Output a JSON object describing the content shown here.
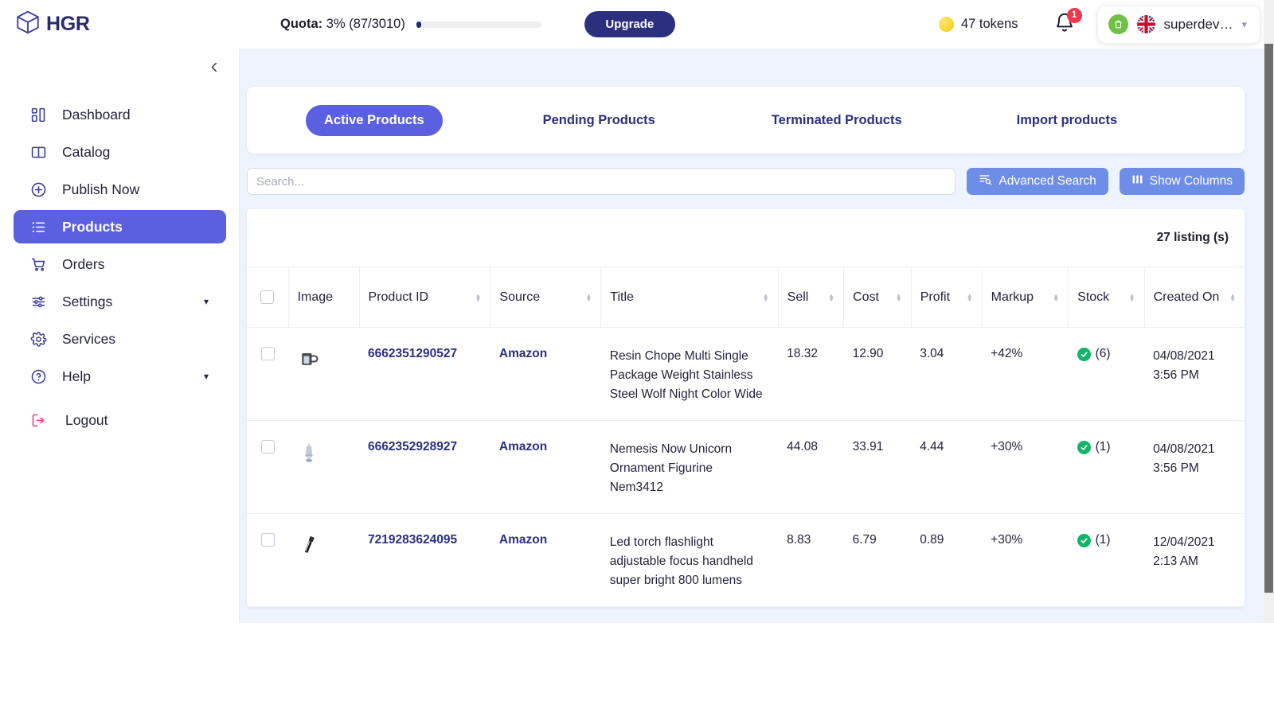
{
  "topbar": {
    "logo_text": "HGR",
    "logo_icon": "cube-icon",
    "quota_label_bold": "Quota:",
    "quota_value": "3% (87/3010)",
    "quota_percent": 3,
    "upgrade_label": "Upgrade",
    "tokens_text": "47 tokens",
    "coin_icon": "coin-icon",
    "bell_icon": "bell-icon",
    "notification_count": "1",
    "shopify_icon": "shopify-bag-icon",
    "shopify_color": "#6ec144",
    "flag_icon": "uk-flag-icon",
    "user_name": "superdev…",
    "chevron_icon": "chevron-down-icon"
  },
  "sidebar": {
    "collapse_icon": "chevron-left-icon",
    "items": [
      {
        "label": "Dashboard",
        "icon": "dashboard-icon",
        "active": false,
        "chevron": false
      },
      {
        "label": "Catalog",
        "icon": "book-icon",
        "active": false,
        "chevron": false
      },
      {
        "label": "Publish Now",
        "icon": "plus-circle-icon",
        "active": false,
        "chevron": false
      },
      {
        "label": "Products",
        "icon": "list-icon",
        "active": true,
        "chevron": false
      },
      {
        "label": "Orders",
        "icon": "cart-icon",
        "active": false,
        "chevron": false
      },
      {
        "label": "Settings",
        "icon": "sliders-icon",
        "active": false,
        "chevron": true
      },
      {
        "label": "Services",
        "icon": "gear-icon",
        "active": false,
        "chevron": false
      },
      {
        "label": "Help",
        "icon": "question-icon",
        "active": false,
        "chevron": true
      },
      {
        "label": "Logout",
        "icon": "logout-icon",
        "active": false,
        "chevron": false
      }
    ]
  },
  "main": {
    "tabs": [
      {
        "label": "Active Products",
        "active": true
      },
      {
        "label": "Pending Products",
        "active": false
      },
      {
        "label": "Terminated Products",
        "active": false
      },
      {
        "label": "Import products",
        "active": false
      }
    ],
    "search": {
      "value": "",
      "placeholder": "Search...",
      "advanced_label": "Advanced Search",
      "advanced_icon": "filter-search-icon",
      "columns_label": "Show Columns",
      "columns_icon": "columns-icon"
    },
    "listing_count": "27 listing (s)",
    "columns": [
      {
        "label": "Image",
        "sortable": false
      },
      {
        "label": "Product ID",
        "sortable": true
      },
      {
        "label": "Source",
        "sortable": true
      },
      {
        "label": "Title",
        "sortable": true
      },
      {
        "label": "Sell",
        "sortable": true
      },
      {
        "label": "Cost",
        "sortable": true
      },
      {
        "label": "Profit",
        "sortable": true
      },
      {
        "label": "Markup",
        "sortable": true
      },
      {
        "label": "Stock",
        "sortable": true
      },
      {
        "label": "Created On",
        "sortable": true
      }
    ],
    "rows": [
      {
        "thumb": "mug-thumbnail",
        "product_id": "6662351290527",
        "source": "Amazon",
        "title": "Resin Chope Multi Single Package Weight Stainless Steel Wolf Night Color Wide",
        "sell": "18.32",
        "cost": "12.90",
        "profit": "3.04",
        "markup": "+42%",
        "stock_status": "in-stock",
        "stock_count": "(6)",
        "created_date": "04/08/2021",
        "created_time": "3:56 PM"
      },
      {
        "thumb": "unicorn-figurine-thumbnail",
        "product_id": "6662352928927",
        "source": "Amazon",
        "title": "Nemesis Now Unicorn Ornament Figurine Nem3412",
        "sell": "44.08",
        "cost": "33.91",
        "profit": "4.44",
        "markup": "+30%",
        "stock_status": "in-stock",
        "stock_count": "(1)",
        "created_date": "04/08/2021",
        "created_time": "3:56 PM"
      },
      {
        "thumb": "flashlight-thumbnail",
        "product_id": "7219283624095",
        "source": "Amazon",
        "title": "Led torch flashlight adjustable focus handheld super bright 800 lumens",
        "sell": "8.83",
        "cost": "6.79",
        "profit": "0.89",
        "markup": "+30%",
        "stock_status": "in-stock",
        "stock_count": "(1)",
        "created_date": "12/04/2021",
        "created_time": "2:13 AM"
      }
    ]
  },
  "colors": {
    "accent_primary": "#5b60e0",
    "accent_dark": "#2b2f7e",
    "button_blue": "#6e8de6",
    "page_bg": "#eef4fd",
    "stock_green": "#13b46a",
    "badge_red": "#f4354a",
    "logout_pink": "#ee3d7f"
  }
}
